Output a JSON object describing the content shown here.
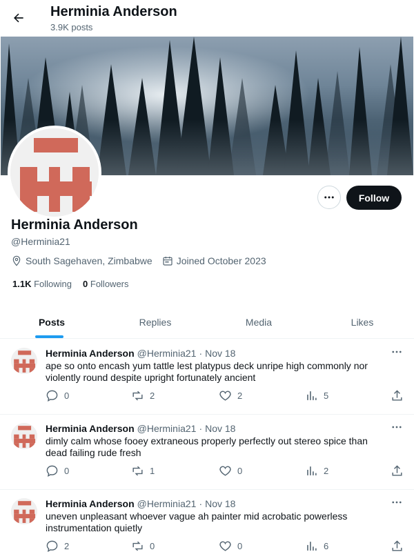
{
  "header": {
    "name": "Herminia Anderson",
    "posts_count": "3.9K posts"
  },
  "profile": {
    "name": "Herminia Anderson",
    "handle": "@Herminia21",
    "location": "South Sagehaven, Zimbabwe",
    "joined": "Joined October 2023",
    "following_count": "1.1K",
    "following_label": "Following",
    "followers_count": "0",
    "followers_label": "Followers",
    "follow_label": "Follow"
  },
  "tabs": [
    {
      "label": "Posts",
      "active": true
    },
    {
      "label": "Replies"
    },
    {
      "label": "Media"
    },
    {
      "label": "Likes"
    }
  ],
  "posts": [
    {
      "name": "Herminia Anderson",
      "handle": "@Herminia21",
      "date": "Nov 18",
      "text": "ape so onto encash yum tattle lest platypus deck unripe high commonly nor violently round despite upright fortunately ancient",
      "replies": "0",
      "reposts": "2",
      "likes": "2",
      "views": "5"
    },
    {
      "name": "Herminia Anderson",
      "handle": "@Herminia21",
      "date": "Nov 18",
      "text": "dimly calm whose fooey extraneous properly perfectly out stereo spice than dead failing rude fresh",
      "replies": "0",
      "reposts": "1",
      "likes": "0",
      "views": "2"
    },
    {
      "name": "Herminia Anderson",
      "handle": "@Herminia21",
      "date": "Nov 18",
      "text": "uneven unpleasant whoever vague ah painter mid acrobatic powerless instrumentation quietly",
      "replies": "2",
      "reposts": "0",
      "likes": "0",
      "views": "6"
    }
  ],
  "colors": {
    "accent": "#1d9bf0",
    "avatar_pattern": "#d0695a",
    "text_primary": "#0f1419",
    "text_secondary": "#536471"
  },
  "icons": [
    "back-arrow-icon",
    "location-pin-icon",
    "calendar-icon",
    "more-icon",
    "reply-icon",
    "repost-icon",
    "like-icon",
    "views-icon",
    "share-icon"
  ]
}
